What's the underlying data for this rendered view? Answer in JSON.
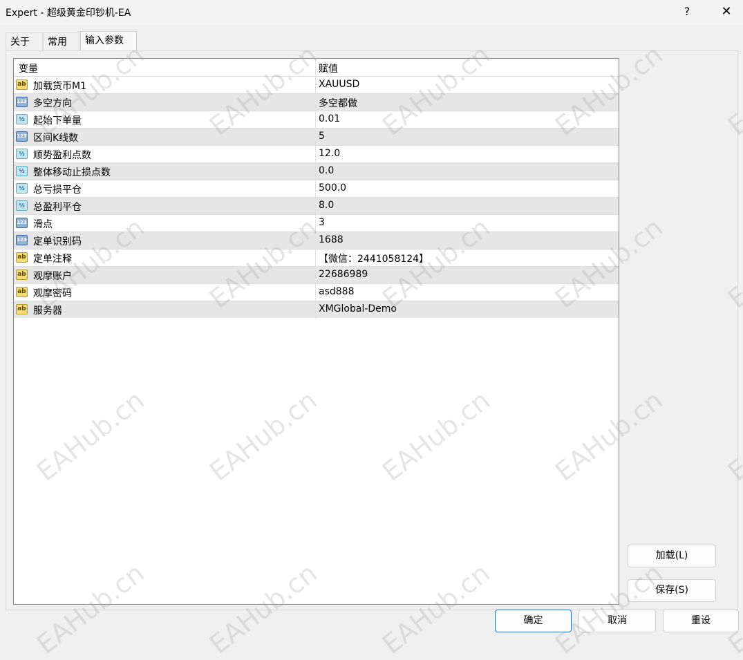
{
  "window": {
    "title": "Expert - 超级黄金印钞机-EA",
    "help_label": "?",
    "close_label": "✕"
  },
  "tabs": [
    {
      "label": "关于"
    },
    {
      "label": "常用"
    },
    {
      "label": "输入参数"
    }
  ],
  "grid": {
    "headers": {
      "variable": "变量",
      "value": "赋值"
    },
    "rows": [
      {
        "type": "ab",
        "name": "加载货币M1",
        "value": "XAUUSD"
      },
      {
        "type": "123",
        "name": "多空方向",
        "value": "多空都做"
      },
      {
        "type": "half",
        "name": "起始下单量",
        "value": "0.01"
      },
      {
        "type": "123",
        "name": "区间K线数",
        "value": "5"
      },
      {
        "type": "half",
        "name": "顺势盈利点数",
        "value": "12.0"
      },
      {
        "type": "half",
        "name": "整体移动止损点数",
        "value": "0.0"
      },
      {
        "type": "half",
        "name": "总亏损平仓",
        "value": "500.0"
      },
      {
        "type": "half",
        "name": "总盈利平仓",
        "value": "8.0"
      },
      {
        "type": "123",
        "name": "滑点",
        "value": "3"
      },
      {
        "type": "123",
        "name": "定单识别码",
        "value": "1688"
      },
      {
        "type": "ab",
        "name": "定单注释",
        "value": "【微信：2441058124】"
      },
      {
        "type": "ab",
        "name": "观摩账户",
        "value": "22686989"
      },
      {
        "type": "ab",
        "name": "观摩密码",
        "value": "asd888"
      },
      {
        "type": "ab",
        "name": "服务器",
        "value": "XMGlobal-Demo"
      }
    ],
    "icon_glyphs": {
      "ab": "ab",
      "123": "123",
      "half": "½"
    }
  },
  "side_buttons": {
    "load": "加载(L)",
    "save": "保存(S)"
  },
  "footer_buttons": {
    "ok": "确定",
    "cancel": "取消",
    "reset": "重设"
  },
  "watermark": "EAHub.cn"
}
